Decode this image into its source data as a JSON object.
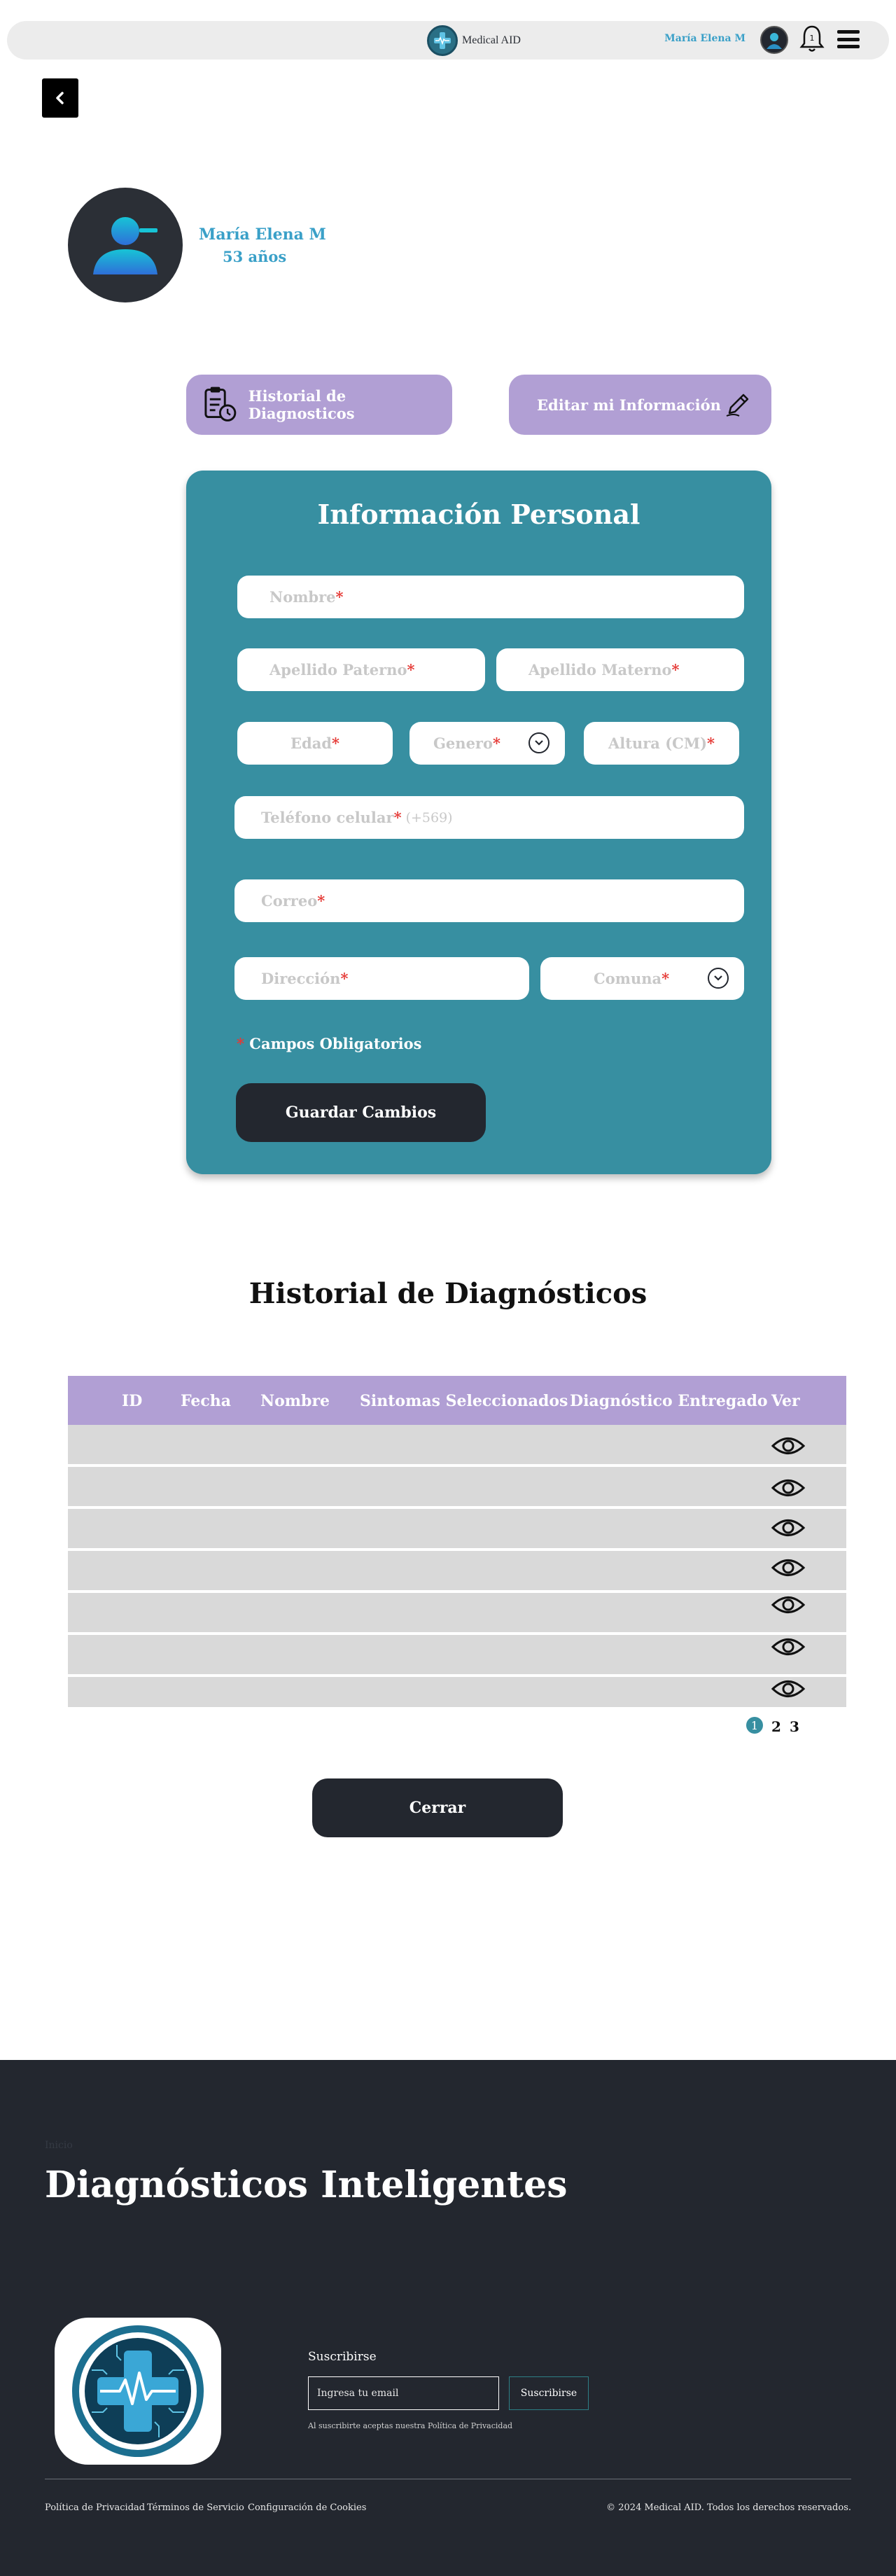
{
  "header": {
    "brand": "Medical AID",
    "user_name": "María Elena M",
    "bell_count": "1"
  },
  "profile": {
    "name": "María Elena M",
    "age": "53 años"
  },
  "actions": {
    "history_label": "Historial de Diagnosticos",
    "edit_label": "Editar mi Información"
  },
  "form": {
    "title": "Información Personal",
    "fields": {
      "nombre": "Nombre",
      "apellido_paterno": "Apellido Paterno",
      "apellido_materno": "Apellido Materno",
      "edad": "Edad",
      "genero": "Genero",
      "altura": "Altura (CM)",
      "telefono": "Teléfono celular",
      "telefono_hint": "(+569)",
      "correo": "Correo",
      "direccion": "Dirección",
      "comuna": "Comuna"
    },
    "required_mark": "*",
    "required_note": "Campos Obligatorios",
    "save_label": "Guardar Cambios"
  },
  "history": {
    "title": "Historial de  Diagnósticos",
    "columns": [
      "ID",
      "Fecha",
      "Nombre",
      "Sintomas Seleccionados",
      "Diagnóstico Entregado",
      "Ver"
    ],
    "row_count": 7,
    "pages": [
      "1",
      "2",
      "3"
    ],
    "close_label": "Cerrar"
  },
  "footer": {
    "small_text": "Inicio",
    "title": "Diagnósticos Inteligentes",
    "subscribe_label": "Suscribirse",
    "email_placeholder": "Ingresa tu email",
    "subscribe_button": "Suscribirse",
    "subscribe_note": "Al suscribirte aceptas nuestra Política de Privacidad",
    "links": [
      "Política de Privacidad",
      "Términos de Servicio",
      "Configuración de Cookies"
    ],
    "copyright": "© 2024 Medical AID. Todos los derechos reservados."
  },
  "colors": {
    "card": "#378fa1",
    "accent_purple": "#b19fd4",
    "dark": "#23272f",
    "name_blue": "#3aa0c8",
    "required_red": "#e53935"
  }
}
